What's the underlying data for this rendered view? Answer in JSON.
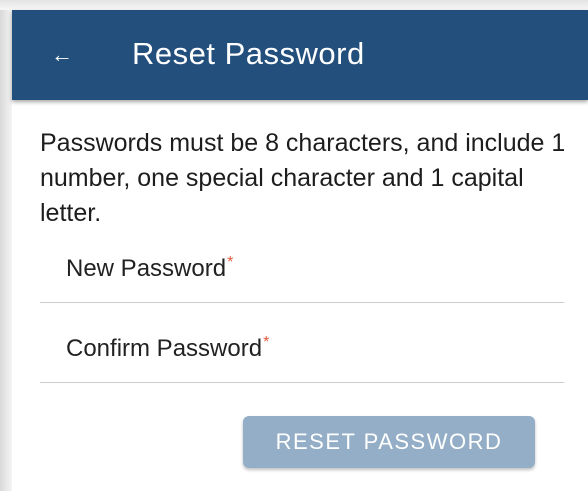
{
  "header": {
    "back_icon": "←",
    "title": "Reset Password",
    "background_color": "#234f7c"
  },
  "instructions": "Passwords must be 8 characters, and include 1 number, one special character and 1 capital letter.",
  "fields": [
    {
      "label": "New Password",
      "required_marker": "*",
      "value": ""
    },
    {
      "label": "Confirm Password",
      "required_marker": "*",
      "value": ""
    }
  ],
  "button": {
    "label": "RESET PASSWORD",
    "state": "disabled",
    "background_color": "#93aec6"
  },
  "colors": {
    "accent": "#234f7c",
    "required": "#e05a3c"
  }
}
